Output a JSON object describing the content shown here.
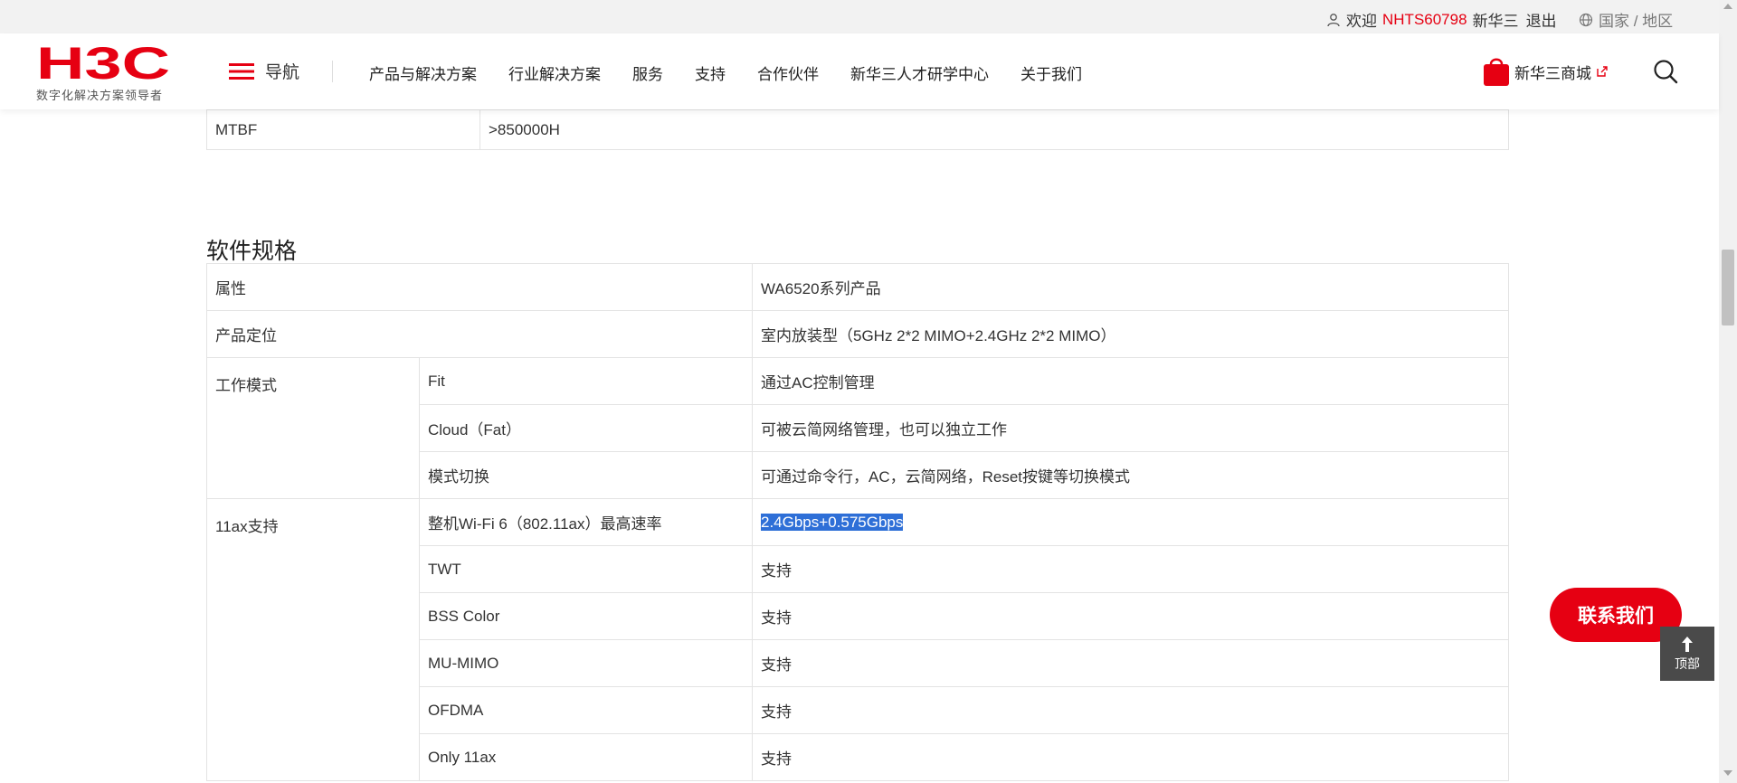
{
  "topbar": {
    "welcome": "欢迎",
    "username": "NHTS60798",
    "company": "新华三",
    "logout": "退出",
    "region": "国家 / 地区"
  },
  "header": {
    "logo_text": "H3C",
    "tagline": "数字化解决方案领导者",
    "nav_label": "导航",
    "menu": [
      "产品与解决方案",
      "行业解决方案",
      "服务",
      "支持",
      "合作伙伴",
      "新华三人才研学中心",
      "关于我们"
    ],
    "mall_label": "新华三商城"
  },
  "mtbf_row": {
    "label": "MTBF",
    "value": ">850000H"
  },
  "software": {
    "title": "软件规格",
    "rows": {
      "attr_label": "属性",
      "attr_value": "WA6520系列产品",
      "position_label": "产品定位",
      "position_value": "室内放装型（5GHz 2*2 MIMO+2.4GHz 2*2 MIMO）",
      "mode_label": "工作模式",
      "fit": "Fit",
      "fit_value": "通过AC控制管理",
      "cloud": "Cloud（Fat）",
      "cloud_value": "可被云简网络管理，也可以独立工作",
      "switch": "模式切换",
      "switch_value": "可通过命令行，AC，云简网络，Reset按键等切换模式",
      "ax_label": "11ax支持",
      "rate": "整机Wi-Fi 6（802.11ax）最高速率",
      "rate_value": "2.4Gbps+0.575Gbps",
      "twt": "TWT",
      "bss": "BSS Color",
      "mumimo": "MU-MIMO",
      "ofdma": "OFDMA",
      "only11ax": "Only 11ax",
      "support": "支持"
    }
  },
  "floating": {
    "contact": "联系我们",
    "top": "顶部"
  },
  "colors": {
    "brand": "#e60012",
    "selection": "#2e6fd7"
  }
}
